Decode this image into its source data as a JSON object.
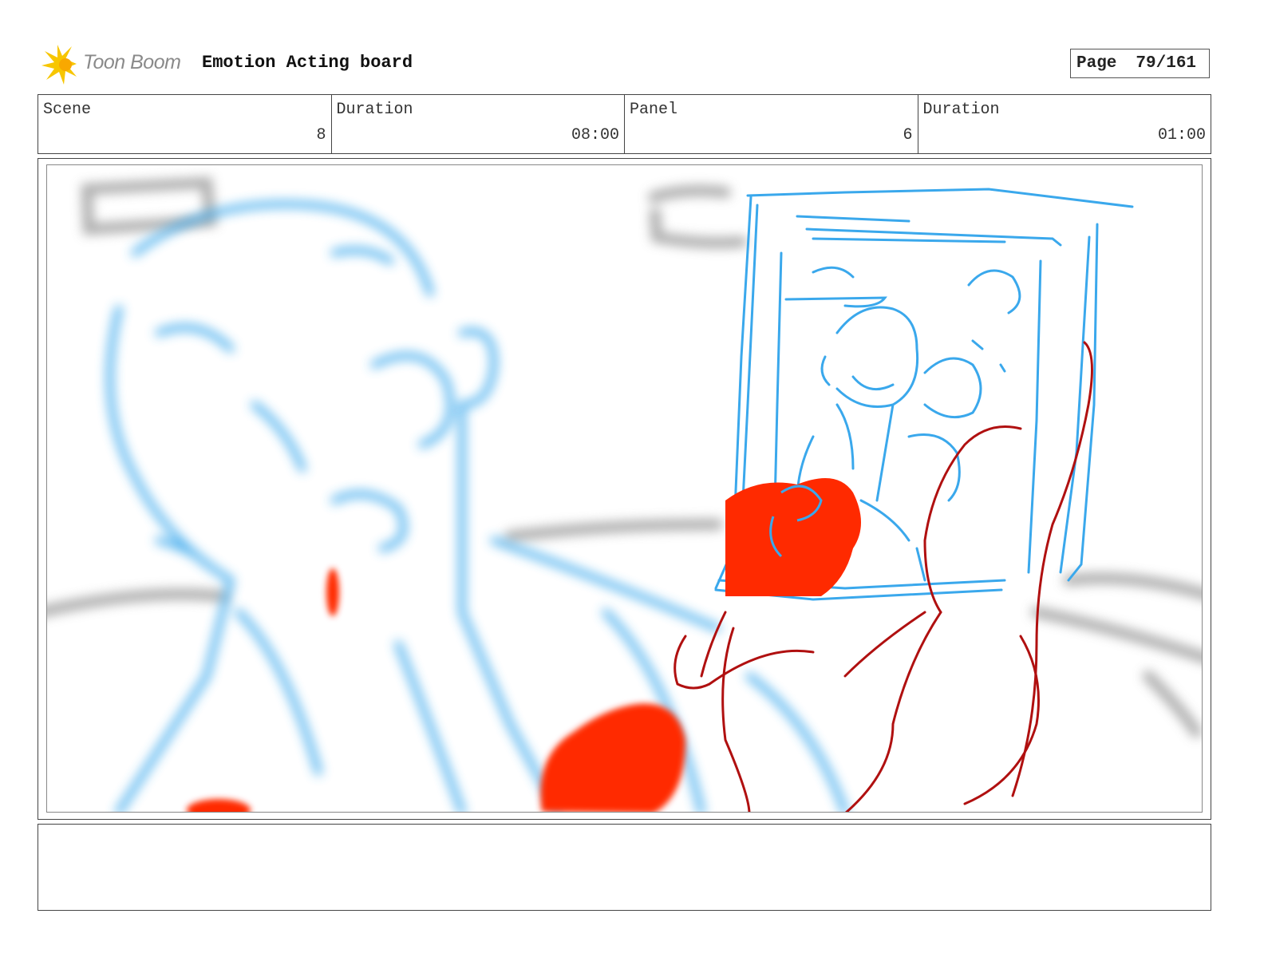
{
  "header": {
    "logo_text": "Toon Boom",
    "board_title": "Emotion Acting board",
    "page_label": "Page",
    "page_value": "79/161"
  },
  "info": {
    "scene_label": "Scene",
    "scene_value": "8",
    "scene_duration_label": "Duration",
    "scene_duration_value": "08:00",
    "panel_label": "Panel",
    "panel_value": "6",
    "panel_duration_label": "Duration",
    "panel_duration_value": "01:00"
  },
  "notes": {
    "text": ""
  },
  "colors": {
    "sketch_blue": "#3aa8ec",
    "sketch_red": "#ff2a00",
    "sketch_darkred": "#b01010",
    "sketch_gray": "#9a9a9a",
    "logo_yellow": "#f7c600"
  }
}
